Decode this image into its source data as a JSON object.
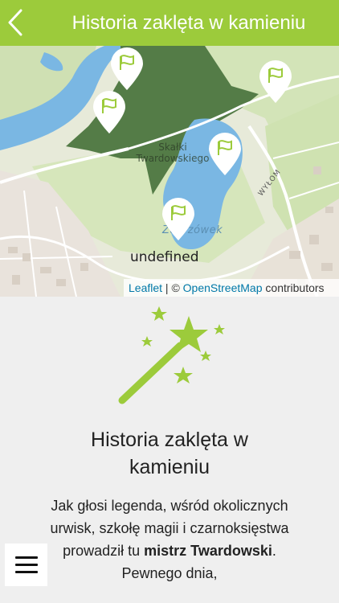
{
  "header": {
    "title": "Historia zaklęta w kamieniu",
    "back_icon": "chevron-left-icon"
  },
  "map": {
    "labels": {
      "forest": "Skałki\nTwardowskiego",
      "lake": "Zakrzówek",
      "street": "WYŁOM"
    },
    "popup_text": "undefined",
    "marker_count": 5,
    "marker_icon": "flag-icon",
    "attribution": {
      "leaflet": "Leaflet",
      "separator": " | © ",
      "osm": "OpenStreetMap",
      "contributors": " contributors"
    },
    "colors": {
      "forest": "#547c47",
      "water": "#7ab7e3",
      "park": "#cfe0b3",
      "urban": "#e8e3dc"
    }
  },
  "content": {
    "icon": "magic-wand-icon",
    "title": "Historia zaklęta w kamieniu",
    "body_part1": "Jak głosi legenda, wśród okolicznych urwisk, szkołę magii i czarnoksięstwa prowadził tu ",
    "body_bold": "mistrz Twardowski",
    "body_part2": ". Pewnego dnia,"
  },
  "menu": {
    "icon": "hamburger-menu-icon"
  },
  "colors": {
    "accent": "#9ccb3b",
    "background": "#efefef"
  }
}
